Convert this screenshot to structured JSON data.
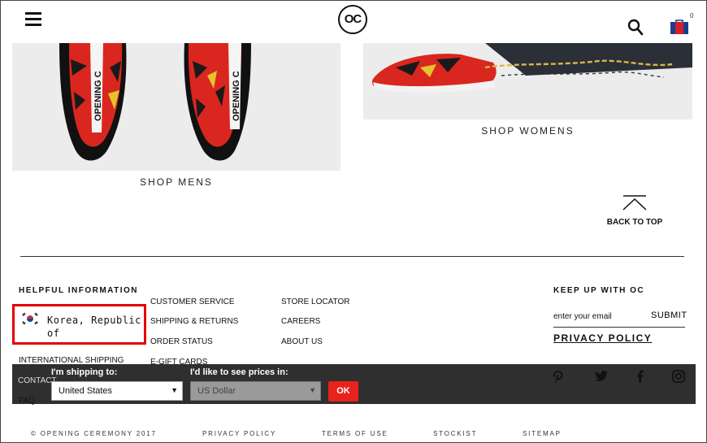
{
  "header": {
    "logo_text": "OC",
    "icons": [
      "hamburger-menu-icon",
      "search-icon",
      "shopping-bag-icon"
    ],
    "bag_count": "0"
  },
  "tiles": {
    "mens_label": "SHOP MENS",
    "womens_label": "SHOP WOMENS",
    "shoe_text": "OPENING C",
    "shoe_text_right": "OPENING C"
  },
  "back_to_top": "BACK TO TOP",
  "footer": {
    "helpful_heading": "HELPFUL INFORMATION",
    "country": "Korea, Republic of",
    "col1": [
      "INTERNATIONAL SHIPPING",
      "CONTACT",
      "FAQ"
    ],
    "col2": [
      "CUSTOMER SERVICE",
      "SHIPPING & RETURNS",
      "ORDER STATUS",
      "E-GIFT CARDS"
    ],
    "col3": [
      "STORE LOCATOR",
      "CAREERS",
      "ABOUT US"
    ],
    "keepup_heading": "KEEP UP WITH OC",
    "email_placeholder": "enter your email",
    "submit": "SUBMIT",
    "privacy": "PRIVACY POLICY",
    "social_icons": [
      "pinterest-icon",
      "twitter-icon",
      "facebook-icon",
      "instagram-icon"
    ]
  },
  "shipping_bar": {
    "ship_label": "I'm shipping to:",
    "ship_value": "United States",
    "currency_label": "I'd like to see prices in:",
    "currency_value": "US Dollar",
    "ok": "OK",
    "colors": {
      "bar": "#2f2f2f",
      "ok": "#e8231b"
    }
  },
  "bottom": {
    "copyright": "© OPENING CEREMONY 2017",
    "links": [
      "PRIVACY POLICY",
      "TERMS OF USE",
      "STOCKIST",
      "SITEMAP"
    ]
  },
  "colors": {
    "highlight_box": "#e30000"
  }
}
